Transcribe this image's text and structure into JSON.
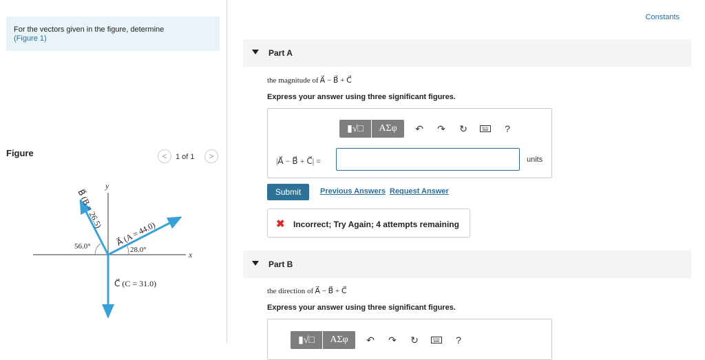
{
  "problem": {
    "text": "For the vectors given in the figure, determine",
    "figure_link": "(Figure 1)"
  },
  "figure": {
    "label": "Figure",
    "pager": {
      "prev": "<",
      "text": "1 of 1",
      "next": ">"
    },
    "axis_y": "y",
    "axis_x": "x",
    "vec_b_label": "B⃗ (B = 26.5)",
    "vec_a_label": "A⃗ (A = 44.0)",
    "vec_c_label": "C⃗ (C = 31.0)",
    "angle_b": "56.0°",
    "angle_a": "28.0°",
    "vector_color": "#3aa0d8"
  },
  "constants_link": "Constants",
  "part_a": {
    "title": "Part A",
    "question": "the magnitude of A⃗ − B⃗ + C⃗",
    "instruction": "Express your answer using three significant figures.",
    "math_label": "|A⃗ − B⃗ + C⃗| =",
    "input_value": "",
    "units": "units",
    "submit": "Submit",
    "previous_answers": "Previous Answers",
    "request_answer": "Request Answer",
    "feedback_icon": "✖",
    "feedback": "Incorrect; Try Again; 4 attempts remaining"
  },
  "part_b": {
    "title": "Part B",
    "question": "the direction of A⃗ − B⃗ + C⃗",
    "instruction": "Express your answer using three significant figures."
  },
  "toolbar": {
    "greek_label": "ΑΣφ",
    "help_label": "?"
  }
}
